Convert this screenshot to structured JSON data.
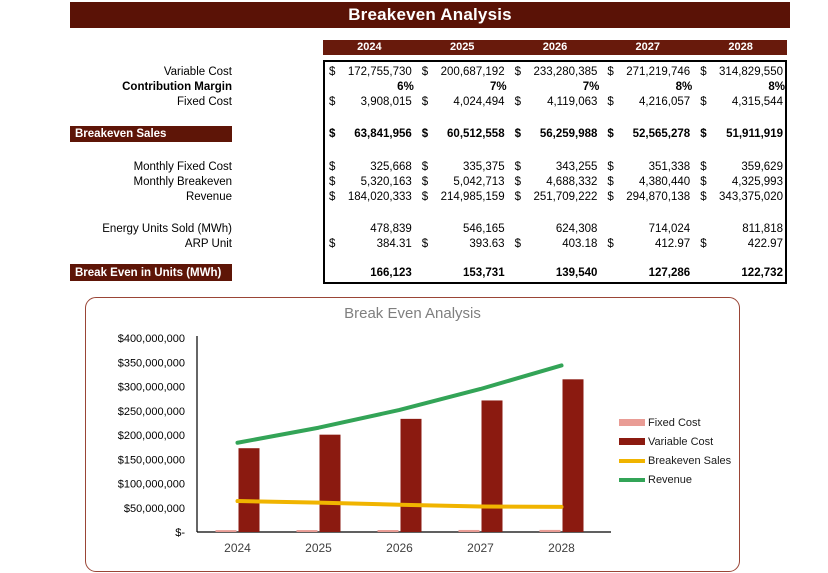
{
  "title": "Breakeven Analysis",
  "years": [
    "2024",
    "2025",
    "2026",
    "2027",
    "2028"
  ],
  "colors": {
    "title_bar": "#5a1206",
    "section_banner": "#5e1507",
    "year_bar": "#681a0c",
    "fixed_cost_bar": "#e99c95",
    "variable_cost_bar": "#8b1a10",
    "breakeven_sales_line": "#f0b400",
    "revenue_line": "#33a457",
    "chart_border": "#9a4536",
    "chart_title_text": "#7f7f7f"
  },
  "table": {
    "rows": [
      {
        "label": "Variable Cost",
        "type": "money",
        "bold": false,
        "values": [
          "172,755,730",
          "200,687,192",
          "233,280,385",
          "271,219,746",
          "314,829,550"
        ]
      },
      {
        "label": "Contribution Margin",
        "type": "percent",
        "bold": true,
        "values": [
          "6%",
          "7%",
          "7%",
          "8%",
          "8%"
        ]
      },
      {
        "label": "Fixed Cost",
        "type": "money",
        "bold": false,
        "values": [
          "3,908,015",
          "4,024,494",
          "4,119,063",
          "4,216,057",
          "4,315,544"
        ]
      },
      {
        "type": "spacer",
        "h": 17
      },
      {
        "label": "Breakeven Sales",
        "type": "money",
        "bold": true,
        "banner": true,
        "h": 16,
        "values": [
          "63,841,956",
          "60,512,558",
          "56,259,988",
          "52,565,278",
          "51,911,919"
        ]
      },
      {
        "type": "spacer",
        "h": 17
      },
      {
        "label": "Monthly Fixed Cost",
        "type": "money",
        "bold": false,
        "values": [
          "325,668",
          "335,375",
          "343,255",
          "351,338",
          "359,629"
        ]
      },
      {
        "label": "Monthly Breakeven",
        "type": "money",
        "bold": false,
        "values": [
          "5,320,163",
          "5,042,713",
          "4,688,332",
          "4,380,440",
          "4,325,993"
        ]
      },
      {
        "label": "Revenue",
        "type": "money",
        "bold": false,
        "values": [
          "184,020,333",
          "214,985,159",
          "251,709,222",
          "294,870,138",
          "343,375,020"
        ]
      },
      {
        "type": "spacer",
        "h": 17
      },
      {
        "label": "Energy Units Sold (MWh)",
        "type": "plain",
        "bold": false,
        "values": [
          "478,839",
          "546,165",
          "624,308",
          "714,024",
          "811,818"
        ]
      },
      {
        "label": "ARP Unit",
        "type": "money",
        "bold": false,
        "values": [
          "384.31",
          "393.63",
          "403.18",
          "412.97",
          "422.97"
        ]
      },
      {
        "type": "spacer",
        "h": 13
      },
      {
        "label": "Break Even in Units (MWh)",
        "type": "plain",
        "bold": true,
        "banner": true,
        "h": 17,
        "values": [
          "166,123",
          "153,731",
          "139,540",
          "127,286",
          "122,732"
        ]
      }
    ]
  },
  "chart_data": {
    "type": "bar",
    "title": "Break Even Analysis",
    "categories": [
      "2024",
      "2025",
      "2026",
      "2027",
      "2028"
    ],
    "series": [
      {
        "name": "Fixed Cost",
        "kind": "bar",
        "color": "#e99c95",
        "values": [
          3908015,
          4024494,
          4119063,
          4216057,
          4315544
        ]
      },
      {
        "name": "Variable Cost",
        "kind": "bar",
        "color": "#8b1a10",
        "values": [
          172755730,
          200687192,
          233280385,
          271219746,
          314829550
        ]
      },
      {
        "name": "Breakeven Sales",
        "kind": "line",
        "color": "#f0b400",
        "values": [
          63841956,
          60512558,
          56259988,
          52565278,
          51911919
        ]
      },
      {
        "name": "Revenue",
        "kind": "line",
        "color": "#33a457",
        "values": [
          184020333,
          214985159,
          251709222,
          294870138,
          343375020
        ]
      }
    ],
    "xlabel": "",
    "ylabel": "",
    "ylim": [
      0,
      400000000
    ],
    "ytick_labels": [
      "$-",
      "$50,000,000",
      "$100,000,000",
      "$150,000,000",
      "$200,000,000",
      "$250,000,000",
      "$300,000,000",
      "$350,000,000",
      "$400,000,000"
    ],
    "grid": false,
    "legend_position": "right"
  }
}
